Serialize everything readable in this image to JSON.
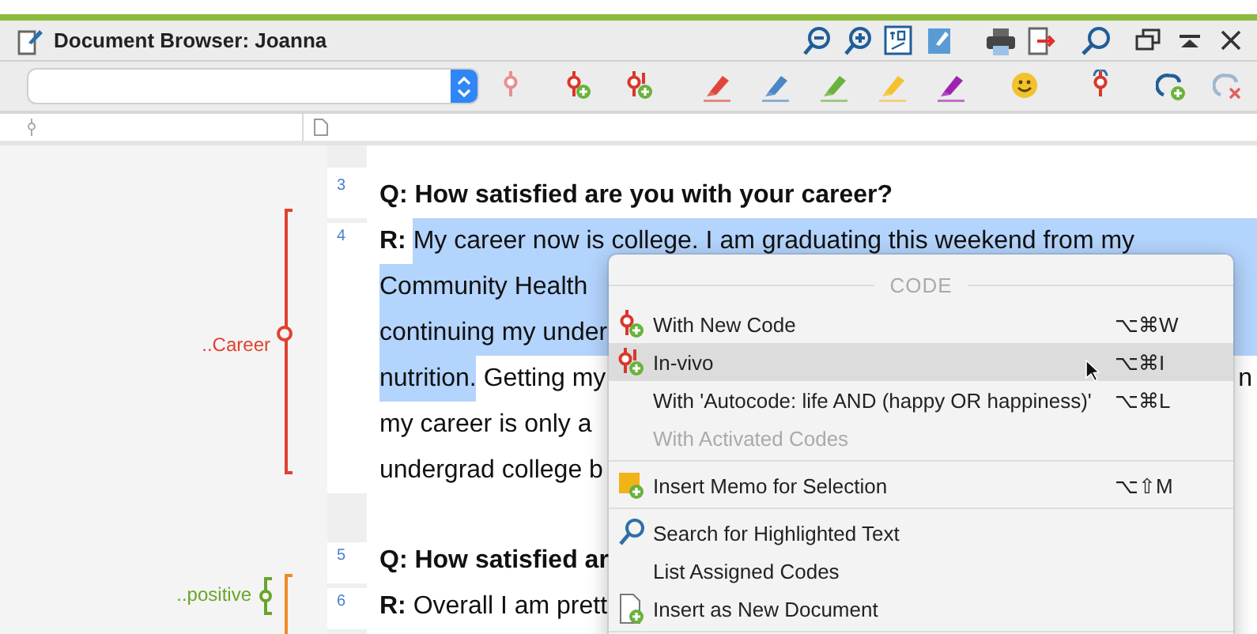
{
  "window": {
    "title": "Document Browser: Joanna"
  },
  "paragraphs": [
    {
      "number": "3",
      "kind": "question",
      "lines": [
        [
          {
            "kind": "text",
            "text": "Q: How satisfied are you with your career?",
            "highlighted": false
          }
        ]
      ]
    },
    {
      "number": "4",
      "kind": "response",
      "codes": [
        {
          "kind": "long",
          "label": "..Career",
          "color": "#e0412f"
        }
      ],
      "lines": [
        [
          {
            "kind": "text",
            "text": "**R:** ",
            "highlighted": false
          },
          {
            "kind": "text",
            "text": "My career now is college. I am graduating this weekend from my",
            "highlighted": true
          }
        ],
        [
          {
            "kind": "text",
            "text": "Community Health",
            "highlighted": true
          }
        ],
        [
          {
            "kind": "text",
            "text": "continuing my under",
            "highlighted": true
          }
        ],
        [
          {
            "kind": "text",
            "text": "nutrition.",
            "highlighted": true
          },
          {
            "kind": "text",
            "text": " Getting my",
            "highlighted": false
          },
          {
            "kind": "tail",
            "text": "n",
            "highlighted": false
          }
        ],
        [
          {
            "kind": "text",
            "text": "my career is only a",
            "highlighted": false
          }
        ],
        [
          {
            "kind": "text",
            "text": "undergrad college b",
            "highlighted": false
          }
        ]
      ]
    },
    {
      "number": "5",
      "kind": "question",
      "lines": [
        [
          {
            "kind": "text",
            "text": "Q: How satisfied ar",
            "highlighted": false
          }
        ]
      ]
    },
    {
      "number": "6",
      "kind": "response",
      "codes": [
        {
          "kind": "short",
          "label": "..positive",
          "color": "#6aa52b"
        },
        {
          "kind": "open",
          "color": "#f08a24"
        }
      ],
      "lines": [
        [
          {
            "kind": "text",
            "text": "**R:** Overall I am prett",
            "highlighted": false
          }
        ]
      ]
    }
  ],
  "context_menu": {
    "title": "CODE",
    "items": [
      {
        "kind": "item",
        "label": "With New Code",
        "shortcut": "⌥⌘W",
        "selected": false,
        "disabled": false
      },
      {
        "kind": "item",
        "label": "In-vivo",
        "shortcut": "⌥⌘I",
        "selected": true,
        "disabled": false
      },
      {
        "kind": "item",
        "label": "With 'Autocode: life AND (happy OR happiness)'",
        "shortcut": "⌥⌘L",
        "selected": false,
        "disabled": false
      },
      {
        "kind": "item",
        "label": "With Activated Codes",
        "selected": false,
        "disabled": true
      },
      {
        "kind": "separator"
      },
      {
        "kind": "item",
        "label": "Insert Memo for Selection",
        "shortcut": "⌥⇧M",
        "selected": false,
        "disabled": false
      },
      {
        "kind": "separator"
      },
      {
        "kind": "item",
        "label": "Search for Highlighted Text",
        "selected": false,
        "disabled": false
      },
      {
        "kind": "item",
        "label": "List Assigned Codes",
        "selected": false,
        "disabled": false
      },
      {
        "kind": "item",
        "label": "Insert as New Document",
        "selected": false,
        "disabled": false
      },
      {
        "kind": "separator"
      }
    ]
  }
}
